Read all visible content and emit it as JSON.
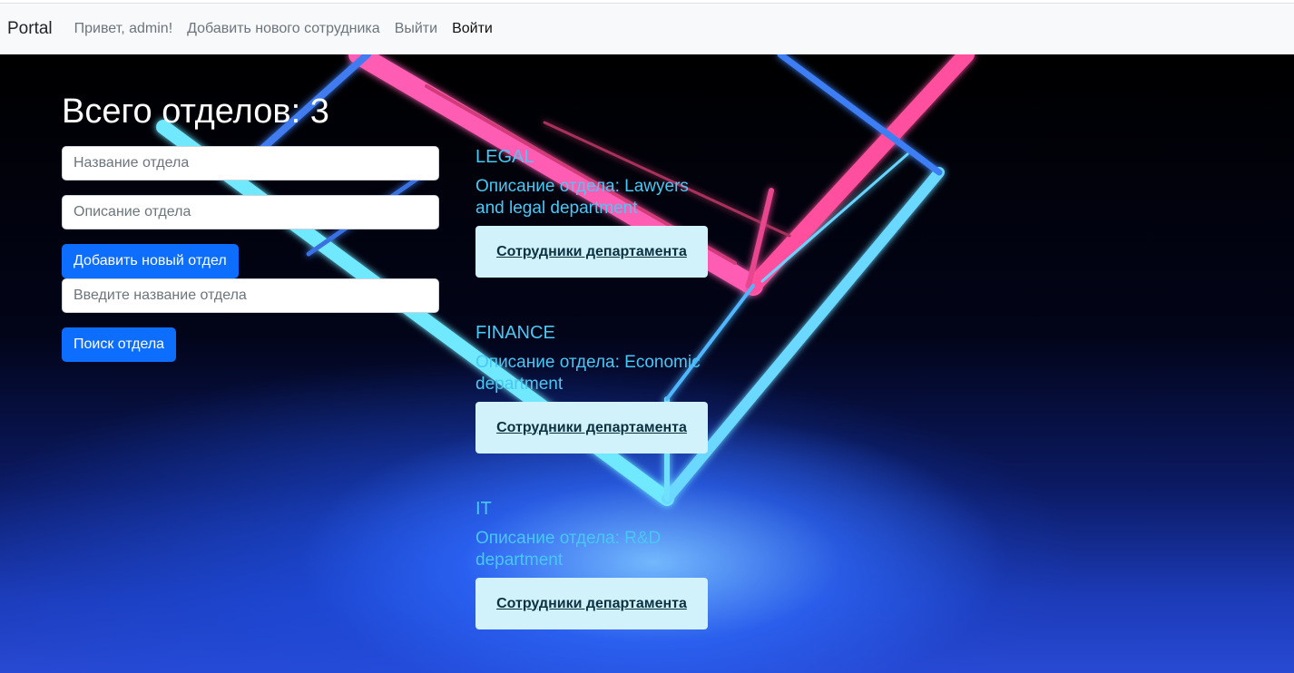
{
  "navbar": {
    "brand": "Portal",
    "greeting": "Привет, admin!",
    "add_employee": "Добавить нового сотрудника",
    "logout": "Выйти",
    "login": "Войти"
  },
  "main": {
    "title": "Всего отделов: 3",
    "form": {
      "name_placeholder": "Название отдела",
      "description_placeholder": "Описание отдела",
      "add_button": "Добавить новый отдел"
    },
    "search": {
      "placeholder": "Введите название отдела",
      "button": "Поиск отдела"
    }
  },
  "departments": [
    {
      "name": "LEGAL",
      "description": "Описание отдела: Lawyers and legal department",
      "employees_button": "Сотрудники департамента"
    },
    {
      "name": "FINANCE",
      "description": "Описание отдела: Economic department",
      "employees_button": "Сотрудники департамента"
    },
    {
      "name": "IT",
      "description": "Описание отдела: R&D department",
      "employees_button": "Сотрудники департамента"
    }
  ],
  "colors": {
    "primary": "#0d6efd",
    "dept_text": "#47c8f5",
    "dept_button_bg": "#d1f1fb",
    "navbar_bg": "#f8f9fa"
  }
}
